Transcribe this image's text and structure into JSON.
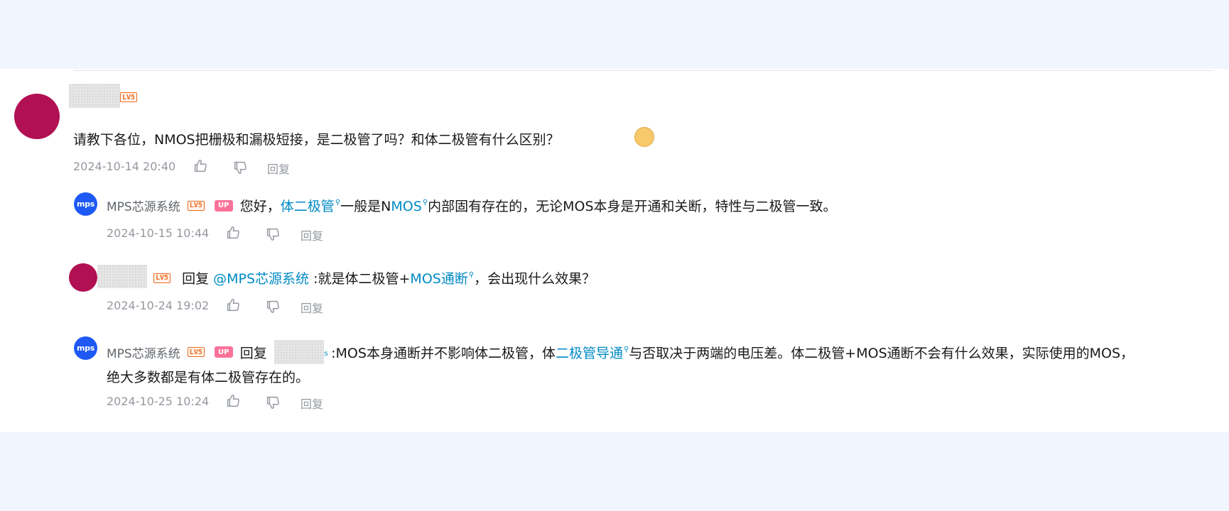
{
  "top_comment": {
    "level": "LV5",
    "content": "请教下各位，NMOS把栅极和漏极短接，是二极管了吗？和体二极管有什么区别？",
    "emoji": "doge-emoji",
    "time": "2024-10-14 20:40",
    "reply_label": "回复"
  },
  "replies": [
    {
      "username": "MPS芯源系统",
      "avatar_text": "mps",
      "level": "LV5",
      "up_badge": "UP",
      "text_parts": [
        "您好，",
        "体二极管",
        "一般是N",
        "MOS",
        "内部固有存在的，无论MOS本身是开通和关断，特性与二极管一致。"
      ],
      "time": "2024-10-15 10:44",
      "reply_label": "回复"
    },
    {
      "level": "LV5",
      "reply_prefix": "回复",
      "mention": "@MPS芯源系统",
      "text_parts": [
        " :就是体二极管+",
        "MOS通断",
        "，会出现什么效果？"
      ],
      "time": "2024-10-24 19:02",
      "reply_label": "回复"
    },
    {
      "username": "MPS芯源系统",
      "avatar_text": "mps",
      "level": "LV5",
      "up_badge": "UP",
      "reply_prefix": "回复",
      "mention_tail": "ₛ",
      "text_parts": [
        ":MOS本身通断并不影响体二极管，体",
        "二极管导通",
        "与否取决于两端的电压差。体二极管+MOS通断不会有什么效果，实际使用的MOS，"
      ],
      "text_line2": "绝大多数都是有体二极管存在的。",
      "time": "2024-10-25 10:24",
      "reply_label": "回复"
    }
  ],
  "colors": {
    "link": "#008ac5",
    "avatar": "#b11052",
    "mps_avatar": "#1d59f2",
    "up": "#fb7299",
    "level": "#f06a1f"
  }
}
